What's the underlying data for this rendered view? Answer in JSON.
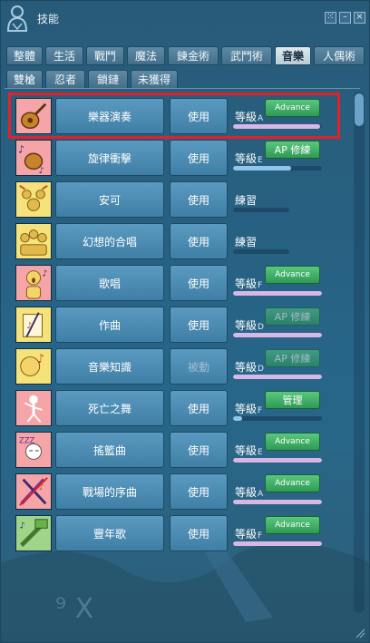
{
  "window": {
    "title": "技能"
  },
  "tabs_row1": [
    "整體",
    "生活",
    "戰鬥",
    "魔法",
    "鍊金術",
    "武鬥術",
    "音樂",
    "人偶術"
  ],
  "tabs_row2": [
    "雙槍",
    "忍者",
    "鎖鏈",
    "未獲得"
  ],
  "active_tab": "音樂",
  "skills": [
    {
      "name": "樂器演奏",
      "use": "使用",
      "level": "等級",
      "grade": "A",
      "action": "Advance",
      "progress": 0.98,
      "icon": "lute-icon"
    },
    {
      "name": "旋律衝擊",
      "use": "使用",
      "level": "等級",
      "grade": "E",
      "action": "AP 修練",
      "progress": 0.65,
      "icon": "melody-shock-icon"
    },
    {
      "name": "安可",
      "use": "使用",
      "level": "練習",
      "grade": "",
      "action": "",
      "progress": 0.0,
      "icon": "encore-icon"
    },
    {
      "name": "幻想的合唱",
      "use": "使用",
      "level": "練習",
      "grade": "",
      "action": "",
      "progress": 0.0,
      "icon": "chorus-icon"
    },
    {
      "name": "歌唱",
      "use": "使用",
      "level": "等級",
      "grade": "F",
      "action": "Advance",
      "progress": 1.0,
      "icon": "singing-icon"
    },
    {
      "name": "作曲",
      "use": "使用",
      "level": "等級",
      "grade": "D",
      "action": "AP 修練",
      "progress": 1.0,
      "icon": "composing-icon"
    },
    {
      "name": "音樂知識",
      "use": "被動",
      "level": "等級",
      "grade": "D",
      "action": "AP 修練",
      "progress": 1.0,
      "icon": "music-knowledge-icon"
    },
    {
      "name": "死亡之舞",
      "use": "使用",
      "level": "等級",
      "grade": "F",
      "action": "管理",
      "progress": 0.1,
      "icon": "dance-of-death-icon"
    },
    {
      "name": "搖籃曲",
      "use": "使用",
      "level": "等級",
      "grade": "E",
      "action": "Advance",
      "progress": 1.0,
      "icon": "lullaby-icon"
    },
    {
      "name": "戰場的序曲",
      "use": "使用",
      "level": "等級",
      "grade": "A",
      "action": "Advance",
      "progress": 1.0,
      "icon": "battlefield-overture-icon"
    },
    {
      "name": "豐年歌",
      "use": "使用",
      "level": "等級",
      "grade": "F",
      "action": "Advance",
      "progress": 1.0,
      "icon": "harvest-song-icon"
    }
  ],
  "colors": {
    "highlight": "#e5202a",
    "action_green": "#3fae66",
    "progress_purple": "#d7b7e6",
    "progress_blue": "#8fc6ea"
  }
}
